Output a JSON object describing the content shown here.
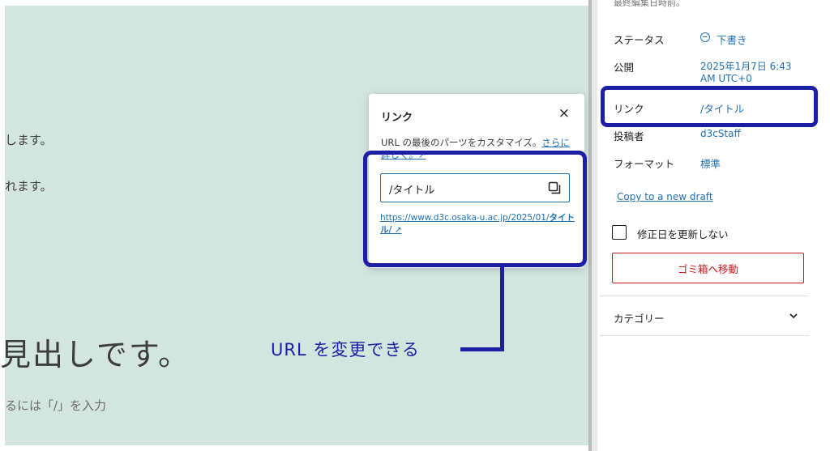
{
  "editor": {
    "line1": "します。",
    "line2": "れます。",
    "heading": "見出しです。",
    "hint": "るには「/」を入力"
  },
  "popover": {
    "title": "リンク",
    "close": "×",
    "description": "URL の最後のパーツをカスタマイズ。",
    "learn_more": "さらに詳しく。↗",
    "slug": "/タイトル",
    "permalink_prefix": "https://www.d3c.osaka-u.ac.jp/2025/01/",
    "permalink_slug": "タイトル/",
    "permalink_suffix": " ↗"
  },
  "annotation": {
    "label": "URL を変更できる",
    "color": "#1d1ea6"
  },
  "sidebar": {
    "cut_text": "最終編集日時前。",
    "status_label": "ステータス",
    "status_value": "下書き",
    "publish_label": "公開",
    "publish_value_1": "2025年1月7日 6:43",
    "publish_value_2": "AM UTC+0",
    "link_label": "リンク",
    "link_value": "/タイトル",
    "author_label": "投稿者",
    "author_value": "d3cStaff",
    "format_label": "フォーマット",
    "format_value": "標準",
    "copy_draft": "Copy to a new draft",
    "checkbox_label": "修正日を更新しない",
    "trash_button": "ゴミ箱へ移動",
    "category_label": "カテゴリー"
  },
  "colors": {
    "canvas_bg": "#d3e5df",
    "accent": "#2271b1",
    "danger": "#cc1818"
  }
}
